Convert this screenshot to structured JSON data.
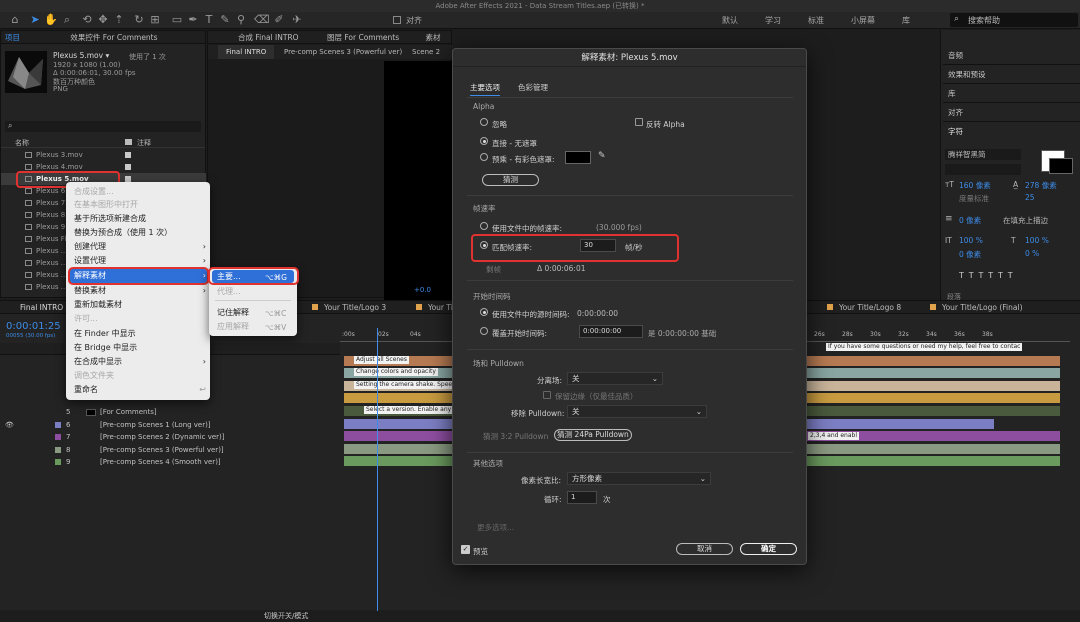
{
  "app": {
    "window_title": "Adobe After Effects 2021 - Data Stream Titles.aep (已转换) *",
    "toolbar": {
      "snap_label": "对齐",
      "workspaces": [
        "默认",
        "学习",
        "标准",
        "小屏幕",
        "库"
      ],
      "search_placeholder": "搜索帮助"
    }
  },
  "project_panel": {
    "tab_project": "项目",
    "tab_effects": "效果控件 For Comments",
    "selected_file": "Plexus 5.mov ▾",
    "used_count": "使用了 1 次",
    "dimensions": "1920 x 1080 (1.00)",
    "duration_fps": "Δ 0:00:06:01, 30.00 fps",
    "colors": "数百万种颜色",
    "codec": "PNG",
    "col_name": "名称",
    "col_comment": "注释",
    "items": [
      "Plexus 3.mov",
      "Plexus 4.mov",
      "Plexus 5.mov",
      "Plexus 6.mov",
      "Plexus 7.mov",
      "Plexus 8.mov",
      "Plexus 9.mov",
      "Plexus Final",
      "Plexus ...P",
      "Plexus ...P",
      "Plexus ...P",
      "Plexus ...P"
    ]
  },
  "context_menu": {
    "items": [
      {
        "label": "合成设置...",
        "disabled": true
      },
      {
        "label": "在基本图形中打开",
        "disabled": true
      },
      {
        "label": "基于所选项新建合成",
        "disabled": false
      },
      {
        "label": "替换为预合成（使用 1 次）",
        "disabled": false
      },
      {
        "label": "创建代理",
        "disabled": false,
        "arrow": true
      },
      {
        "label": "设置代理",
        "disabled": false,
        "arrow": true
      },
      {
        "label": "解释素材",
        "disabled": false,
        "arrow": true,
        "active": true
      },
      {
        "label": "替换素材",
        "disabled": false,
        "arrow": true
      },
      {
        "label": "重新加载素材",
        "disabled": false
      },
      {
        "label": "许可...",
        "disabled": true
      },
      {
        "label": "在 Finder 中显示",
        "disabled": false
      },
      {
        "label": "在 Bridge 中显示",
        "disabled": false
      },
      {
        "label": "在合成中显示",
        "disabled": false,
        "arrow": true
      },
      {
        "label": "调色文件夹",
        "disabled": true
      },
      {
        "label": "重命名",
        "disabled": false
      }
    ],
    "submenu": [
      {
        "label": "主要...",
        "shortcut": "⌥⌘G",
        "active": true
      },
      {
        "label": "代理...",
        "shortcut": "",
        "disabled": true
      },
      {
        "label": "记住解释",
        "shortcut": "⌥⌘C"
      },
      {
        "label": "应用解释",
        "shortcut": "⌥⌘V",
        "disabled": true
      }
    ]
  },
  "comp_viewer": {
    "tab_comp": "合成 Final INTRO",
    "tab_layer": "图层 For Comments",
    "tab_footage": "素材（无）",
    "crumbs": [
      "Final INTRO",
      "Pre-comp Scenes 3 (Powerful ver)",
      "Scene 2"
    ],
    "zoom": "+0.0"
  },
  "timeline": {
    "tabs": [
      "Final INTRO",
      "Your Title/Logo 3",
      "Your Tit",
      "Your Title/Logo 8",
      "Your Title/Logo (Final)"
    ],
    "timecode": "0:00:01:25",
    "timecode_sub": "00055 (30.00 fps)",
    "ruler": [
      ":00s",
      "02s",
      "04s",
      "26s",
      "28s",
      "30s",
      "32s",
      "34s",
      "36s",
      "38s"
    ],
    "layers": [
      {
        "num": "5",
        "name": "[For Comments]"
      },
      {
        "num": "6",
        "name": "[Pre-comp Scenes 1 (Long ver)]"
      },
      {
        "num": "7",
        "name": "[Pre-comp Scenes 2 (Dynamic ver)]"
      },
      {
        "num": "8",
        "name": "[Pre-comp Scenes 3 (Powerful ver)]"
      },
      {
        "num": "9",
        "name": "[Pre-comp Scenes 4 (Smooth ver)]"
      }
    ],
    "markers": [
      "Adjust all Scenes",
      "Change colors and opacity",
      "Setting the camera shake. Speed,",
      "Select a version. Enable any l",
      "If you have some questions or need my help, feel free to contac",
      "2,3,4  and enabl"
    ],
    "footer": "切换开关/模式"
  },
  "right_panel": {
    "items": [
      "信息",
      "音频",
      "效果和预设",
      "库",
      "对齐",
      "字符"
    ],
    "font": "腾祥智黑简",
    "font_size": "160 像素",
    "leading": "278 像素",
    "tracking_label": "度量标准",
    "tracking": "25",
    "stroke": "0 像素",
    "stroke_mode": "在填充上描边",
    "v_scale": "100 %",
    "h_scale": "100 %",
    "baseline": "0 像素",
    "tsume": "0 %",
    "para": "段落"
  },
  "dialog": {
    "title": "解释素材: Plexus 5.mov",
    "tabs": [
      "主要选项",
      "色彩管理"
    ],
    "alpha": {
      "heading": "Alpha",
      "ignore": "忽略",
      "invert": "反转 Alpha",
      "straight": "直接 - 无遮罩",
      "premult": "预乘 - 有彩色遮罩:",
      "guess": "猜测"
    },
    "framerate": {
      "heading": "帧速率",
      "use_file": "使用文件中的帧速率:",
      "use_file_value": "(30.000 fps)",
      "conform": "匹配帧速率:",
      "conform_value": "30",
      "unit": "帧/秒",
      "remaining_label": "剩帧",
      "remaining_value": "Δ 0:00:06:01"
    },
    "start_tc": {
      "heading": "开始时间码",
      "use_file": "使用文件中的源时间码:",
      "use_file_value": "0:00:00:00",
      "override": "覆盖开始时间码:",
      "override_value": "0:00:00:00",
      "base": "是 0:00:00:00  基础"
    },
    "fields": {
      "heading": "场和 Pulldown",
      "separate_label": "分离场:",
      "separate_value": "关",
      "preserve_edges": "保留边缘（仅最佳品质）",
      "remove_label": "移除 Pulldown:",
      "remove_value": "关",
      "guess32": "猜测 3:2 Pulldown",
      "guess24": "猜测 24Pa Pulldown"
    },
    "other": {
      "heading": "其他选项",
      "par_label": "像素长宽比:",
      "par_value": "方形像素",
      "loop_label": "循环:",
      "loop_value": "1",
      "loop_unit": "次",
      "more": "更多选项..."
    },
    "preview": "预览",
    "cancel": "取消",
    "ok": "确定"
  },
  "colors": {
    "accent": "#3d8ce8",
    "highlight": "#e0322f",
    "menu_active": "#2f6fd8"
  }
}
